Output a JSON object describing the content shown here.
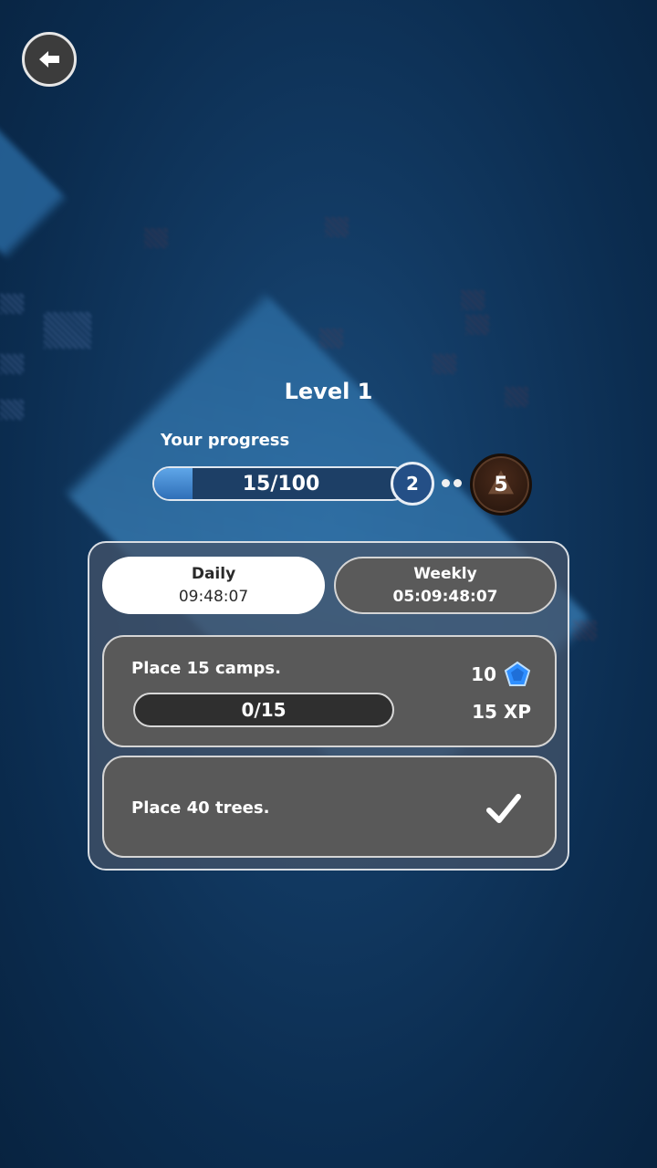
{
  "header": {
    "level_title": "Level 1",
    "progress_label": "Your progress"
  },
  "progress": {
    "value": 15,
    "max": 100,
    "text": "15/100",
    "next_level": "2",
    "rank_badge": "5"
  },
  "tabs": [
    {
      "label": "Daily",
      "time": "09:48:07",
      "active": true
    },
    {
      "label": "Weekly",
      "time": "05:09:48:07",
      "active": false
    }
  ],
  "missions": [
    {
      "description": "Place 15 camps.",
      "progress_text": "0/15",
      "progress": 0,
      "reward_gems": "10",
      "reward_xp": "15 XP",
      "completed": false
    },
    {
      "description": "Place 40 trees.",
      "completed": true
    }
  ],
  "icons": {
    "back": "arrow-left-icon",
    "gem": "gem-icon",
    "check": "check-icon",
    "tree": "tree-icon"
  },
  "colors": {
    "accent": "#2f6fb8",
    "gem": "#2f8fff",
    "badge": "#3a2214"
  }
}
